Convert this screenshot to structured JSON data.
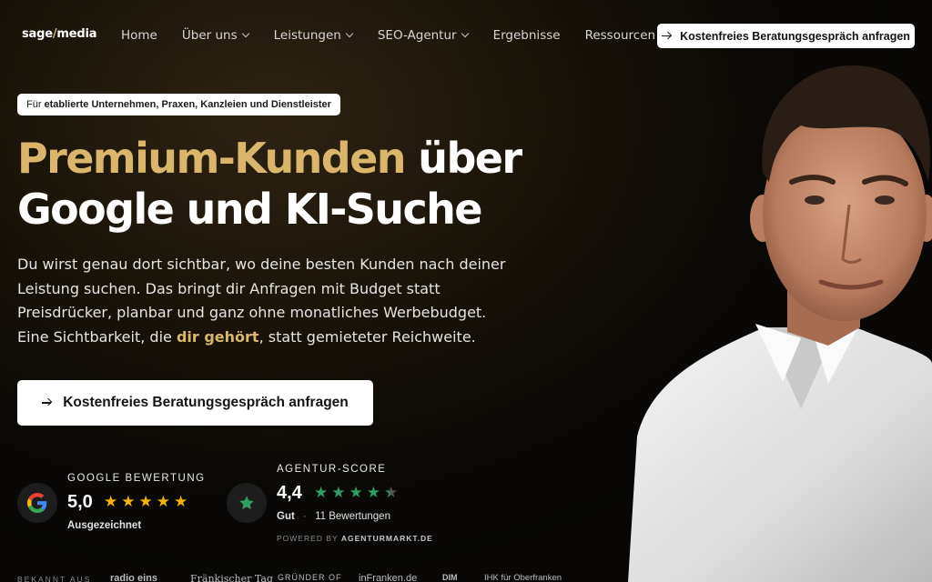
{
  "brand": {
    "left": "sage",
    "slash": "/",
    "right": "media"
  },
  "nav": {
    "items": [
      {
        "label": "Home",
        "dropdown": false
      },
      {
        "label": "Über uns",
        "dropdown": true
      },
      {
        "label": "Leistungen",
        "dropdown": true
      },
      {
        "label": "SEO-Agentur",
        "dropdown": true
      },
      {
        "label": "Ergebnisse",
        "dropdown": false
      },
      {
        "label": "Ressourcen",
        "dropdown": true
      }
    ],
    "cta_label": "Kostenfreies Beratungsgespräch anfragen"
  },
  "hero": {
    "badge_prefix": "Für",
    "badge_bold": "etablierte Unternehmen, Praxen, Kanzleien und Dienstleister",
    "headline_gold": "Premium-Kunden",
    "headline_rest1": " über",
    "headline_line2": "Google und KI-Suche",
    "sub_line1": "Du wirst genau dort sichtbar, wo deine besten Kunden nach deiner",
    "sub_line2": "Leistung suchen. Das bringt dir Anfragen mit Budget statt",
    "sub_line3": "Preisdrücker, planbar und ganz ohne monatliches Werbebudget.",
    "sub_line4_pre": "Eine Sichtbarkeit, die ",
    "sub_line4_hl": "dir gehört",
    "sub_line4_post": ", statt gemieteter Reichweite.",
    "cta_label": "Kostenfreies Beratungsgespräch anfragen"
  },
  "ratings": {
    "google": {
      "label": "GOOGLE BEWERTUNG",
      "score": "5,0",
      "stars": 5,
      "caption": "Ausgezeichnet"
    },
    "agentur": {
      "label": "AGENTUR-SCORE",
      "score": "4,4",
      "stars": 4.4,
      "caption_word": "Gut",
      "separator": "·",
      "reviews": "11 Bewertungen",
      "powered_prefix": "POWERED BY",
      "powered_brand": "AGENTURMARKT.DE"
    }
  },
  "press": {
    "label": "BEKANNT AUS",
    "logos": [
      "radio eins",
      "Fränkischer Tag",
      "GRÜNDER OF",
      "inFranken.de",
      "DIM",
      "IHK für Oberfranken"
    ]
  },
  "colors": {
    "gold": "#d9b66b",
    "star_gold": "#f4b400",
    "star_green": "#2e9e62",
    "background": "#0b0906"
  },
  "icons": {
    "google": "google-g-icon",
    "agentur": "green-star-icon",
    "arrow": "arrow-right-icon",
    "chevron": "chevron-down-icon"
  }
}
